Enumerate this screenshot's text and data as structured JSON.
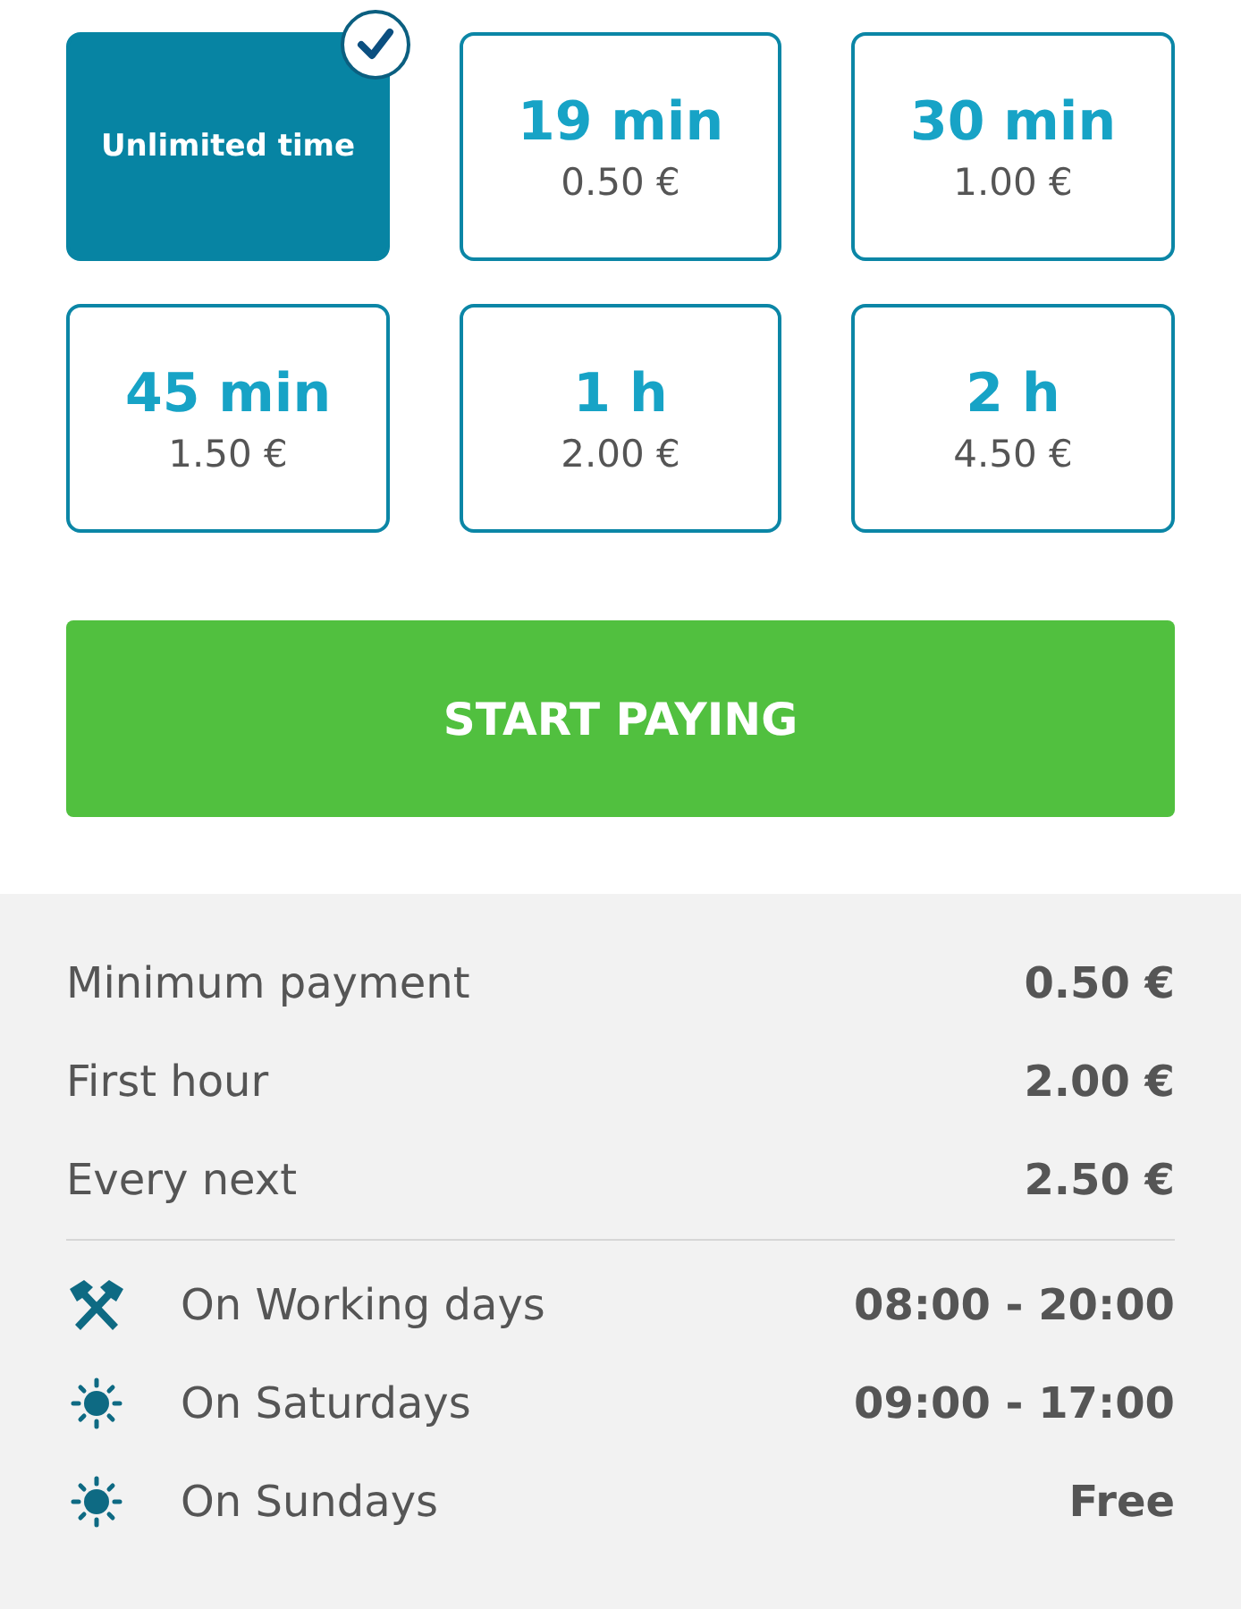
{
  "options": [
    {
      "label": "Unlimited time",
      "selected": true
    },
    {
      "label": "19 min",
      "price": "0.50 €",
      "selected": false
    },
    {
      "label": "30 min",
      "price": "1.00 €",
      "selected": false
    },
    {
      "label": "45 min",
      "price": "1.50 €",
      "selected": false
    },
    {
      "label": "1 h",
      "price": "2.00 €",
      "selected": false
    },
    {
      "label": "2 h",
      "price": "4.50 €",
      "selected": false
    }
  ],
  "start_button": "START PAYING",
  "tariffs": [
    {
      "label": "Minimum payment",
      "value": "0.50 €"
    },
    {
      "label": "First hour",
      "value": "2.00 €"
    },
    {
      "label": "Every next",
      "value": "2.50 €"
    }
  ],
  "schedule": [
    {
      "kind": "hammers",
      "label": "On Working days",
      "value": "08:00 - 20:00"
    },
    {
      "kind": "sun",
      "label": "On Saturdays",
      "value": "09:00 - 17:00"
    },
    {
      "kind": "sun",
      "label": "On Sundays",
      "value": "Free"
    }
  ]
}
